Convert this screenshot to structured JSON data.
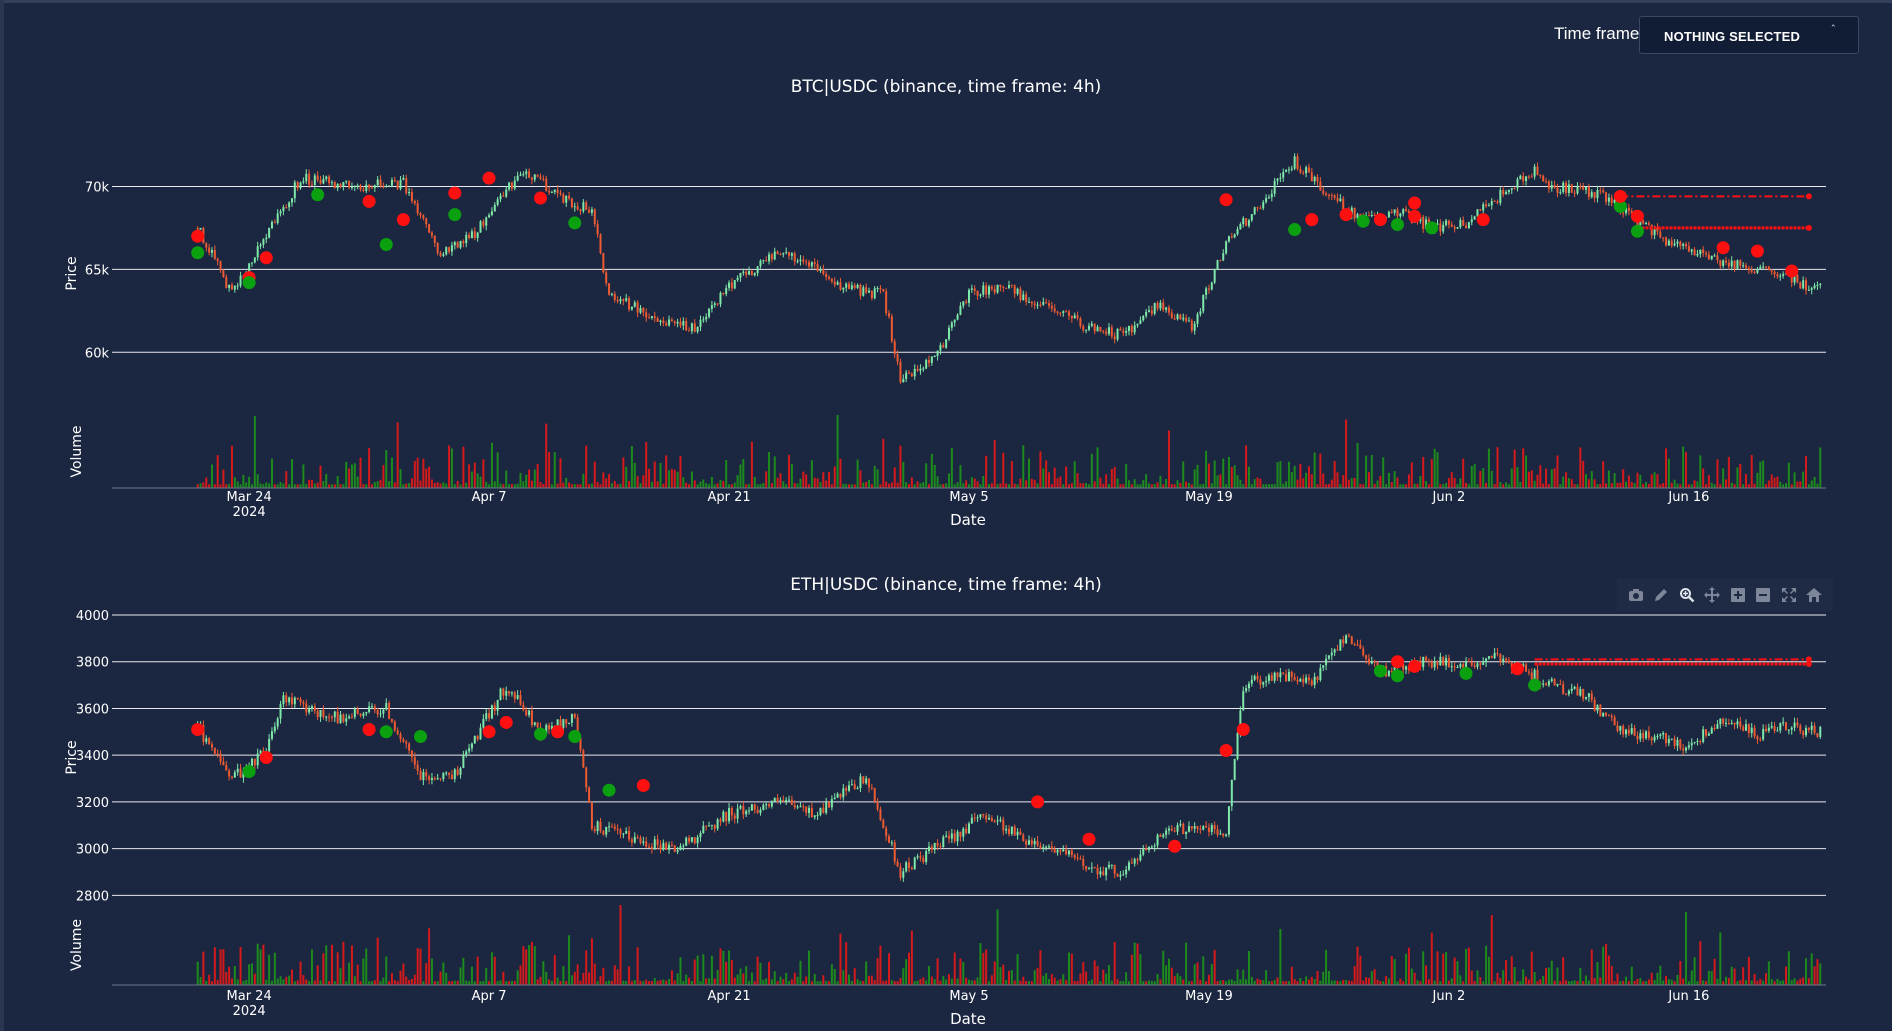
{
  "timeframe": {
    "label": "Time frame",
    "selected": "NOTHING SELECTED"
  },
  "modebar": {
    "icons": [
      "camera-icon",
      "pencil-icon",
      "zoom-icon",
      "pan-icon",
      "zoom-in-icon",
      "zoom-out-icon",
      "autoscale-icon",
      "home-icon"
    ]
  },
  "colors": {
    "background": "#1b2640",
    "up": "#7ee8a8",
    "down": "#ee5a32",
    "vol_up": "#1c8a1c",
    "vol_down": "#d41a1a",
    "signal_red": "#ff1010",
    "signal_green": "#0aa010"
  },
  "chart_data": [
    {
      "type": "candlestick",
      "title": "BTC|USDC (binance, time frame: 4h)",
      "xlabel": "Date",
      "ylabel": "Price",
      "volume_label": "Volume",
      "x_range": [
        "2024-03-16",
        "2024-06-24"
      ],
      "ylim": [
        57000,
        72500
      ],
      "y_ticks": [
        60000,
        65000,
        70000
      ],
      "y_tick_labels": [
        "60k",
        "65k",
        "70k"
      ],
      "x_ticks": [
        "2024-03-24",
        "2024-04-07",
        "2024-04-21",
        "2024-05-05",
        "2024-05-19",
        "2024-06-02",
        "2024-06-16"
      ],
      "x_tick_labels": [
        "Mar 24",
        "Apr 7",
        "Apr 21",
        "May 5",
        "May 19",
        "Jun 2",
        "Jun 16"
      ],
      "x_year_label": "2024",
      "grid": true,
      "price_path": [
        [
          "2024-03-21",
          67500
        ],
        [
          "2024-03-23",
          63500
        ],
        [
          "2024-03-25",
          67000
        ],
        [
          "2024-03-27",
          70500
        ],
        [
          "2024-03-30",
          70000
        ],
        [
          "2024-04-02",
          70200
        ],
        [
          "2024-04-04",
          66000
        ],
        [
          "2024-04-06",
          67000
        ],
        [
          "2024-04-09",
          71000
        ],
        [
          "2024-04-11",
          69500
        ],
        [
          "2024-04-13",
          68500
        ],
        [
          "2024-04-14",
          63500
        ],
        [
          "2024-04-17",
          62000
        ],
        [
          "2024-04-19",
          61500
        ],
        [
          "2024-04-21",
          64000
        ],
        [
          "2024-04-24",
          66000
        ],
        [
          "2024-04-26",
          65000
        ],
        [
          "2024-04-28",
          63800
        ],
        [
          "2024-04-30",
          63500
        ],
        [
          "2024-05-01",
          58500
        ],
        [
          "2024-05-03",
          59500
        ],
        [
          "2024-05-05",
          63500
        ],
        [
          "2024-05-07",
          64000
        ],
        [
          "2024-05-10",
          62500
        ],
        [
          "2024-05-12",
          61500
        ],
        [
          "2024-05-14",
          61000
        ],
        [
          "2024-05-16",
          62800
        ],
        [
          "2024-05-18",
          61500
        ],
        [
          "2024-05-20",
          66500
        ],
        [
          "2024-05-22",
          69000
        ],
        [
          "2024-05-24",
          71500
        ],
        [
          "2024-05-26",
          69500
        ],
        [
          "2024-05-28",
          68000
        ],
        [
          "2024-05-30",
          68500
        ],
        [
          "2024-06-01",
          67500
        ],
        [
          "2024-06-03",
          67800
        ],
        [
          "2024-06-05",
          69500
        ],
        [
          "2024-06-07",
          71000
        ],
        [
          "2024-06-08",
          70000
        ],
        [
          "2024-06-11",
          69500
        ],
        [
          "2024-06-13",
          68000
        ],
        [
          "2024-06-15",
          66500
        ],
        [
          "2024-06-18",
          65500
        ],
        [
          "2024-06-20",
          65000
        ],
        [
          "2024-06-22",
          64500
        ],
        [
          "2024-06-23",
          63800
        ]
      ],
      "markers": [
        {
          "date": "2024-03-21",
          "price": 67000,
          "color": "red"
        },
        {
          "date": "2024-03-21",
          "price": 66000,
          "color": "green"
        },
        {
          "date": "2024-03-24",
          "price": 64500,
          "color": "red"
        },
        {
          "date": "2024-03-24",
          "price": 64200,
          "color": "green"
        },
        {
          "date": "2024-03-25",
          "price": 65700,
          "color": "red"
        },
        {
          "date": "2024-03-28",
          "price": 69500,
          "color": "green"
        },
        {
          "date": "2024-03-31",
          "price": 69100,
          "color": "red"
        },
        {
          "date": "2024-04-01",
          "price": 66500,
          "color": "green"
        },
        {
          "date": "2024-04-02",
          "price": 68000,
          "color": "red"
        },
        {
          "date": "2024-04-05",
          "price": 69600,
          "color": "red"
        },
        {
          "date": "2024-04-05",
          "price": 68300,
          "color": "green"
        },
        {
          "date": "2024-04-07",
          "price": 70500,
          "color": "red"
        },
        {
          "date": "2024-04-10",
          "price": 69300,
          "color": "red"
        },
        {
          "date": "2024-04-12",
          "price": 67800,
          "color": "green"
        },
        {
          "date": "2024-05-20",
          "price": 69200,
          "color": "red"
        },
        {
          "date": "2024-05-24",
          "price": 67400,
          "color": "green"
        },
        {
          "date": "2024-05-25",
          "price": 68000,
          "color": "red"
        },
        {
          "date": "2024-05-27",
          "price": 68300,
          "color": "red"
        },
        {
          "date": "2024-05-28",
          "price": 67900,
          "color": "green"
        },
        {
          "date": "2024-05-29",
          "price": 68000,
          "color": "red"
        },
        {
          "date": "2024-05-30",
          "price": 67700,
          "color": "green"
        },
        {
          "date": "2024-05-31",
          "price": 68200,
          "color": "red"
        },
        {
          "date": "2024-05-31",
          "price": 69000,
          "color": "red"
        },
        {
          "date": "2024-06-01",
          "price": 67500,
          "color": "green"
        },
        {
          "date": "2024-06-04",
          "price": 68000,
          "color": "red"
        },
        {
          "date": "2024-06-12",
          "price": 68800,
          "color": "green"
        },
        {
          "date": "2024-06-12",
          "price": 69400,
          "color": "red"
        },
        {
          "date": "2024-06-13",
          "price": 68200,
          "color": "red"
        },
        {
          "date": "2024-06-13",
          "price": 67300,
          "color": "green"
        },
        {
          "date": "2024-06-18",
          "price": 66300,
          "color": "red"
        },
        {
          "date": "2024-06-20",
          "price": 66100,
          "color": "red"
        },
        {
          "date": "2024-06-22",
          "price": 64900,
          "color": "red"
        }
      ],
      "levels": [
        {
          "price": 69400,
          "from": "2024-06-12",
          "to": "2024-06-23",
          "style": "dashdot"
        },
        {
          "price": 67500,
          "from": "2024-06-13",
          "to": "2024-06-23",
          "style": "solid"
        }
      ]
    },
    {
      "type": "candlestick",
      "title": "ETH|USDC (binance, time frame: 4h)",
      "xlabel": "Date",
      "ylabel": "Price",
      "volume_label": "Volume",
      "x_range": [
        "2024-03-16",
        "2024-06-24"
      ],
      "ylim": [
        2780,
        4000
      ],
      "y_ticks": [
        2800,
        3000,
        3200,
        3400,
        3600,
        3800,
        4000
      ],
      "y_tick_labels": [
        "2800",
        "3000",
        "3200",
        "3400",
        "3600",
        "3800",
        "4000"
      ],
      "x_ticks": [
        "2024-03-24",
        "2024-04-07",
        "2024-04-21",
        "2024-05-05",
        "2024-05-19",
        "2024-06-02",
        "2024-06-16"
      ],
      "x_tick_labels": [
        "Mar 24",
        "Apr 7",
        "Apr 21",
        "May 5",
        "May 19",
        "Jun 2",
        "Jun 16"
      ],
      "x_year_label": "2024",
      "grid": true,
      "price_path": [
        [
          "2024-03-21",
          3520
        ],
        [
          "2024-03-23",
          3300
        ],
        [
          "2024-03-25",
          3420
        ],
        [
          "2024-03-26",
          3640
        ],
        [
          "2024-03-29",
          3560
        ],
        [
          "2024-04-01",
          3600
        ],
        [
          "2024-04-03",
          3300
        ],
        [
          "2024-04-05",
          3320
        ],
        [
          "2024-04-08",
          3700
        ],
        [
          "2024-04-10",
          3500
        ],
        [
          "2024-04-12",
          3560
        ],
        [
          "2024-04-13",
          3100
        ],
        [
          "2024-04-15",
          3050
        ],
        [
          "2024-04-18",
          3000
        ],
        [
          "2024-04-21",
          3150
        ],
        [
          "2024-04-24",
          3200
        ],
        [
          "2024-04-26",
          3150
        ],
        [
          "2024-04-29",
          3300
        ],
        [
          "2024-05-01",
          2900
        ],
        [
          "2024-05-03",
          3000
        ],
        [
          "2024-05-06",
          3150
        ],
        [
          "2024-05-08",
          3050
        ],
        [
          "2024-05-10",
          3000
        ],
        [
          "2024-05-12",
          2920
        ],
        [
          "2024-05-14",
          2900
        ],
        [
          "2024-05-16",
          3050
        ],
        [
          "2024-05-18",
          3100
        ],
        [
          "2024-05-20",
          3060
        ],
        [
          "2024-05-21",
          3700
        ],
        [
          "2024-05-23",
          3750
        ],
        [
          "2024-05-25",
          3700
        ],
        [
          "2024-05-27",
          3920
        ],
        [
          "2024-05-29",
          3760
        ],
        [
          "2024-06-01",
          3800
        ],
        [
          "2024-06-03",
          3780
        ],
        [
          "2024-06-05",
          3820
        ],
        [
          "2024-06-08",
          3700
        ],
        [
          "2024-06-10",
          3650
        ],
        [
          "2024-06-12",
          3500
        ],
        [
          "2024-06-14",
          3480
        ],
        [
          "2024-06-16",
          3440
        ],
        [
          "2024-06-18",
          3560
        ],
        [
          "2024-06-20",
          3480
        ],
        [
          "2024-06-22",
          3530
        ],
        [
          "2024-06-23",
          3500
        ]
      ],
      "markers": [
        {
          "date": "2024-03-21",
          "price": 3510,
          "color": "red"
        },
        {
          "date": "2024-03-24",
          "price": 3330,
          "color": "green"
        },
        {
          "date": "2024-03-25",
          "price": 3390,
          "color": "red"
        },
        {
          "date": "2024-03-31",
          "price": 3510,
          "color": "red"
        },
        {
          "date": "2024-04-01",
          "price": 3500,
          "color": "green"
        },
        {
          "date": "2024-04-03",
          "price": 3480,
          "color": "green"
        },
        {
          "date": "2024-04-07",
          "price": 3500,
          "color": "red"
        },
        {
          "date": "2024-04-08",
          "price": 3540,
          "color": "red"
        },
        {
          "date": "2024-04-10",
          "price": 3490,
          "color": "green"
        },
        {
          "date": "2024-04-11",
          "price": 3500,
          "color": "red"
        },
        {
          "date": "2024-04-12",
          "price": 3480,
          "color": "green"
        },
        {
          "date": "2024-04-14",
          "price": 3250,
          "color": "green"
        },
        {
          "date": "2024-04-16",
          "price": 3270,
          "color": "red"
        },
        {
          "date": "2024-05-09",
          "price": 3200,
          "color": "red"
        },
        {
          "date": "2024-05-12",
          "price": 3040,
          "color": "red"
        },
        {
          "date": "2024-05-17",
          "price": 3010,
          "color": "red"
        },
        {
          "date": "2024-05-20",
          "price": 3420,
          "color": "red"
        },
        {
          "date": "2024-05-21",
          "price": 3510,
          "color": "red"
        },
        {
          "date": "2024-05-29",
          "price": 3760,
          "color": "green"
        },
        {
          "date": "2024-05-30",
          "price": 3800,
          "color": "red"
        },
        {
          "date": "2024-05-30",
          "price": 3740,
          "color": "green"
        },
        {
          "date": "2024-05-31",
          "price": 3780,
          "color": "red"
        },
        {
          "date": "2024-06-03",
          "price": 3750,
          "color": "green"
        },
        {
          "date": "2024-06-06",
          "price": 3770,
          "color": "red"
        },
        {
          "date": "2024-06-07",
          "price": 3700,
          "color": "green"
        }
      ],
      "levels": [
        {
          "price": 3810,
          "from": "2024-06-07",
          "to": "2024-06-23",
          "style": "dashdot"
        },
        {
          "price": 3790,
          "from": "2024-06-07",
          "to": "2024-06-23",
          "style": "solid"
        }
      ]
    }
  ]
}
